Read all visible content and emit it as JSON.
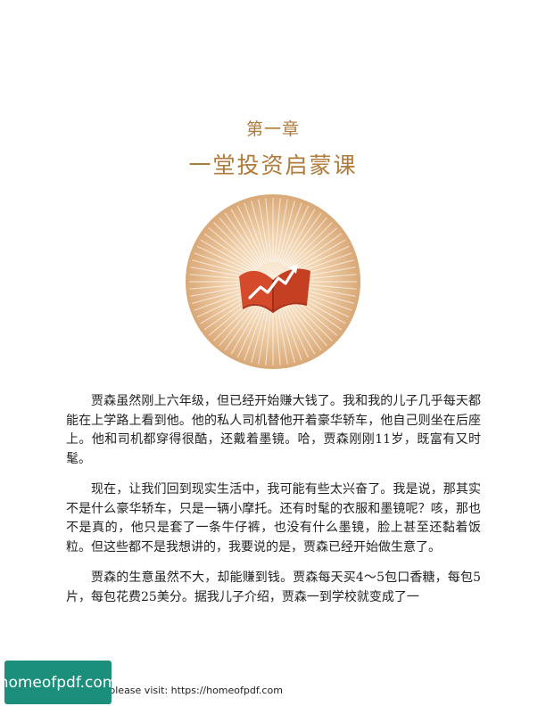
{
  "chapter": {
    "label": "第一章",
    "title": "一堂投资启蒙课"
  },
  "emblem": {
    "icon": "book-with-rising-chart-icon",
    "colors": {
      "circle_center": "#f6e3c8",
      "circle_edge": "#d9a877",
      "book": "#d44a2a",
      "arrow": "#ffffff"
    }
  },
  "paragraphs": [
    "贾森虽然刚上六年级，但已经开始赚大钱了。我和我的儿子几乎每天都能在上学路上看到他。他的私人司机替他开着豪华轿车，他自己则坐在后座上。他和司机都穿得很酷，还戴着墨镜。哈，贾森刚刚11岁，既富有又时髦。",
    "现在，让我们回到现实生活中，我可能有些太兴奋了。我是说，那其实不是什么豪华轿车，只是一辆小摩托。还有时髦的衣服和墨镜呢？咳，那也不是真的，他只是套了一条牛仔裤，也没有什么墨镜，脸上甚至还黏着饭粒。但这些都不是我想讲的，我要说的是，贾森已经开始做生意了。",
    "贾森的生意虽然不大，却能赚到钱。贾森每天买4～5包口香糖，每包5片，每包花费25美分。据我儿子介绍，贾森一到学校就变成了一"
  ],
  "footer": {
    "text": "e please visit: https://homeofpdf.com",
    "badge": "homeofpdf.com",
    "badge_color": "#1b8f7c"
  }
}
